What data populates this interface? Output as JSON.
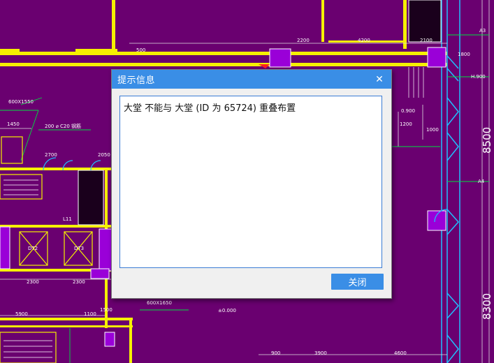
{
  "dialog": {
    "title": "提示信息",
    "close_glyph": "✕",
    "message": "大堂 不能与 大堂 (ID 为 65724) 重叠布置",
    "close_button_label": "关闭",
    "accent_color": "#3a8ee6"
  },
  "drawing": {
    "background_color": "#6a0070",
    "labels": {
      "dim_1450": "1450",
      "dim_2200": "2200",
      "dim_4200": "4200",
      "dim_2100": "2100",
      "dim_1800": "1800",
      "dim_1200": "1200",
      "dim_1000": "1000",
      "dim_2700": "2700",
      "dim_2050": "2050",
      "dim_2300a": "2300",
      "dim_2300b": "2300",
      "dim_5900": "5900",
      "dim_1100": "1100",
      "dim_1500": "1500",
      "dim_900": "900",
      "dim_3900": "3900",
      "dim_4600": "4600",
      "dim_500": "500",
      "beam_600x1550": "600X1550",
      "beam_600x1650": "600X1650",
      "rebar": "200  ⌀ C20  钢筋",
      "level": "±0.000",
      "height_0900": "0.900",
      "height_h0900": "H.900",
      "big_8500": "8500",
      "big_8300": "8300",
      "dt2": "DT2",
      "dt3": "DT3",
      "l11": "L11",
      "a3": "A3",
      "a4": "A4"
    }
  }
}
